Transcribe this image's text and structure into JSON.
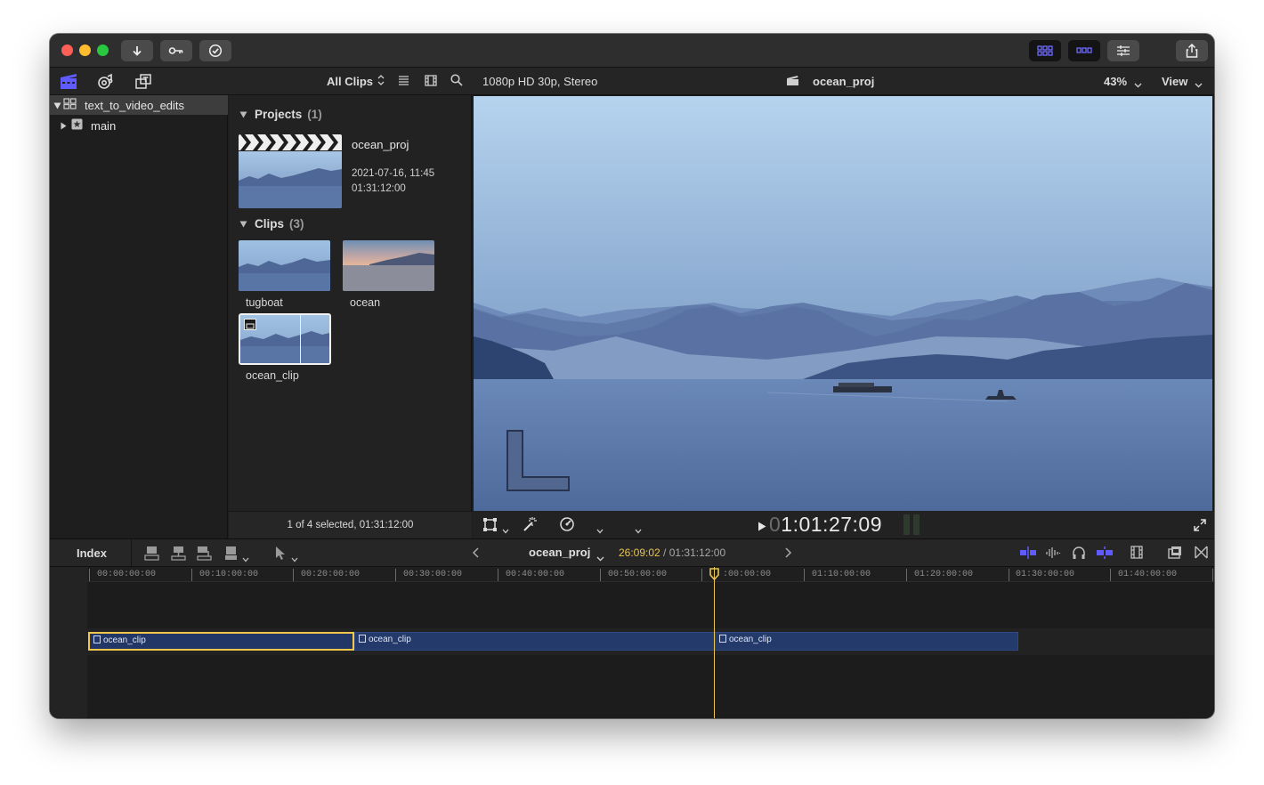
{
  "colors": {
    "accent_blue": "#5f5bff",
    "selection_yellow": "#f2c64a",
    "playhead_yellow": "#e8c553",
    "clip_blue": "#243a6a"
  },
  "titlebar": {
    "buttons": [
      "import-icon",
      "keywords-icon",
      "background-tasks-icon"
    ],
    "right_buttons": [
      "browser-view-icon",
      "timeline-view-icon",
      "inspector-icon",
      "share-icon"
    ]
  },
  "library_toolbar": {
    "icons": [
      "libraries-icon",
      "photos-audio-icon",
      "titles-generators-icon"
    ],
    "filter_label": "All Clips"
  },
  "sidebar": {
    "library_name": "text_to_video_edits",
    "event_name": "main"
  },
  "browser": {
    "projects_header": "Projects",
    "projects_count": "(1)",
    "project": {
      "name": "ocean_proj",
      "date": "2021-07-16, 11:45",
      "duration": "01:31:12:00"
    },
    "clips_header": "Clips",
    "clips_count": "(3)",
    "clips": [
      {
        "label": "tugboat"
      },
      {
        "label": "ocean"
      },
      {
        "label": "ocean_clip"
      }
    ],
    "footer": "1 of 4 selected, 01:31:12:00"
  },
  "viewer": {
    "format": "1080p HD 30p, Stereo",
    "project_name": "ocean_proj",
    "zoom": "43%",
    "view_label": "View",
    "timecode_dim": "0",
    "timecode": "1:01:27:09"
  },
  "timeline_toolbar": {
    "index_label": "Index",
    "project_name": "ocean_proj",
    "position": "26:09:02",
    "separator": " / ",
    "total": "01:31:12:00"
  },
  "timeline": {
    "ruler_labels": [
      "00:00:00:00",
      "00:10:00:00",
      "00:20:00:00",
      "00:30:00:00",
      "00:40:00:00",
      "00:50:00:00",
      ":00:00:00",
      "01:10:00:00",
      "01:20:00:00",
      "01:30:00:00",
      "01:40:00:00"
    ],
    "clips": [
      {
        "label": "ocean_clip"
      },
      {
        "label": "ocean_clip"
      },
      {
        "label": "ocean_clip"
      }
    ]
  }
}
